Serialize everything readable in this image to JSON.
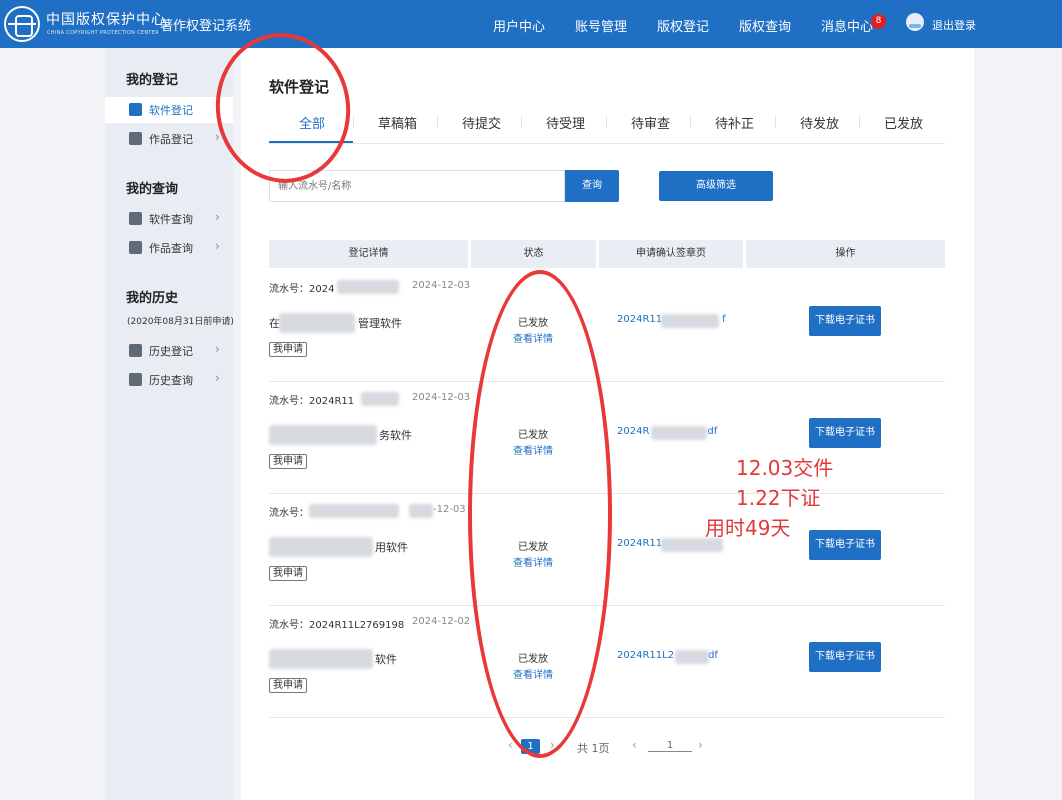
{
  "header": {
    "logo_text": "中国版权保护中心",
    "logo_sub": "CHINA COPYRIGHT PROTECTION CENTER",
    "system_title": "著作权登记系统",
    "nav": [
      "用户中心",
      "账号管理",
      "版权登记",
      "版权查询",
      "消息中心"
    ],
    "message_badge": "8",
    "logout": "退出登录"
  },
  "sidebar": {
    "sections": [
      {
        "title": "我的登记",
        "items": [
          "软件登记",
          "作品登记"
        ]
      },
      {
        "title": "我的查询",
        "items": [
          "软件查询",
          "作品查询"
        ]
      },
      {
        "title": "我的历史",
        "note": "(2020年08月31日前申请)",
        "items": [
          "历史登记",
          "历史查询"
        ]
      }
    ],
    "active_item": "软件登记"
  },
  "main": {
    "title": "软件登记",
    "tabs": [
      "全部",
      "草稿箱",
      "待提交",
      "待受理",
      "待审查",
      "待补正",
      "待发放",
      "已发放"
    ],
    "active_tab": "全部",
    "search_placeholder": "输入流水号/名称",
    "search_button": "查询",
    "advanced_button": "高级筛选",
    "table_headers": [
      "登记详情",
      "状态",
      "申请确认签章页",
      "操作"
    ],
    "rows": [
      {
        "serial": "流水号：2024",
        "date": "2024-12-03",
        "name_prefix": "在",
        "name_suffix": "管理软件",
        "tag": "我申请",
        "status": "已发放",
        "detail": "查看详情",
        "pdf_prefix": "2024R11",
        "pdf_suffix": "f",
        "action": "下载电子证书"
      },
      {
        "serial": "流水号：2024R11",
        "date": "2024-12-03",
        "name_prefix": "",
        "name_suffix": "务软件",
        "tag": "我申请",
        "status": "已发放",
        "detail": "查看详情",
        "pdf_prefix": "2024R",
        "pdf_suffix": "df",
        "action": "下载电子证书"
      },
      {
        "serial": "流水号：",
        "date": "-12-03",
        "name_prefix": "",
        "name_suffix": "用软件",
        "tag": "我申请",
        "status": "已发放",
        "detail": "查看详情",
        "pdf_prefix": "2024R11",
        "pdf_suffix": "",
        "action": "下载电子证书"
      },
      {
        "serial": "流水号：2024R11L2769198",
        "date": "2024-12-02",
        "name_prefix": "",
        "name_suffix": "软件",
        "tag": "我申请",
        "status": "已发放",
        "detail": "查看详情",
        "pdf_prefix": "2024R11L2",
        "pdf_suffix": "df",
        "action": "下载电子证书"
      }
    ],
    "pagination": {
      "current": "1",
      "total": "共 1页",
      "goto": "1"
    }
  },
  "annotation": {
    "lines": [
      "12.03交件",
      "1.22下证",
      "用时49天"
    ],
    "color": "#e03a3a"
  },
  "colors": {
    "brand": "#1f6fc4",
    "annotation_ring": "#e83838"
  }
}
